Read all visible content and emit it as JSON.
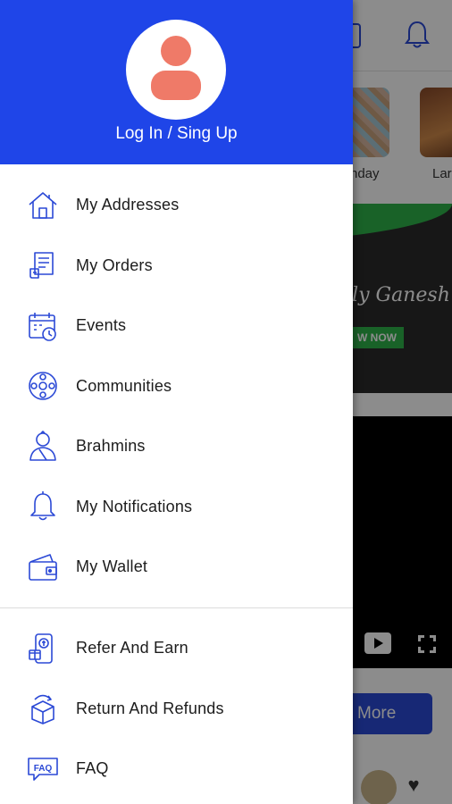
{
  "background": {
    "categories": [
      {
        "label": "hday"
      },
      {
        "label": "Lar"
      }
    ],
    "banner_text": "dly Ganesh",
    "banner_button": "W NOW",
    "more_button": "More"
  },
  "drawer": {
    "login_label": "Log In / Sing Up",
    "menu_items": [
      {
        "label": "My Addresses",
        "icon": "home-icon"
      },
      {
        "label": "My Orders",
        "icon": "orders-icon"
      },
      {
        "label": "Events",
        "icon": "calendar-icon"
      },
      {
        "label": "Communities",
        "icon": "communities-icon"
      },
      {
        "label": "Brahmins",
        "icon": "brahmin-icon"
      },
      {
        "label": "My Notifications",
        "icon": "bell-icon"
      },
      {
        "label": "My Wallet",
        "icon": "wallet-icon"
      }
    ],
    "secondary_items": [
      {
        "label": "Refer And Earn",
        "icon": "refer-icon"
      },
      {
        "label": "Return And Refunds",
        "icon": "return-icon"
      },
      {
        "label": "FAQ",
        "icon": "faq-icon"
      }
    ]
  },
  "colors": {
    "brand_blue": "#1f45e8",
    "avatar_coral": "#ef7a68",
    "icon_blue": "#2b49d6"
  }
}
